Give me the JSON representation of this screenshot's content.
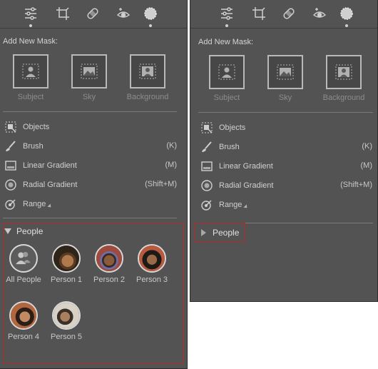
{
  "toolbar_icons": [
    "edit-sliders-icon",
    "crop-icon",
    "healing-icon",
    "red-eye-icon",
    "masking-icon"
  ],
  "add_new_mask": {
    "label": "Add New Mask:",
    "tiles": [
      {
        "name": "subject",
        "label": "Subject",
        "icon": "subject-icon"
      },
      {
        "name": "sky",
        "label": "Sky",
        "icon": "sky-icon"
      },
      {
        "name": "background",
        "label": "Background",
        "icon": "background-icon"
      }
    ]
  },
  "tools": [
    {
      "name": "objects",
      "label": "Objects",
      "shortcut": "",
      "icon": "objects-icon"
    },
    {
      "name": "brush",
      "label": "Brush",
      "shortcut": "(K)",
      "icon": "brush-icon"
    },
    {
      "name": "linear-gradient",
      "label": "Linear Gradient",
      "shortcut": "(M)",
      "icon": "linear-gradient-icon"
    },
    {
      "name": "radial-gradient",
      "label": "Radial Gradient",
      "shortcut": "(Shift+M)",
      "icon": "radial-gradient-icon"
    },
    {
      "name": "range",
      "label": "Range",
      "shortcut": "",
      "icon": "range-icon"
    }
  ],
  "people": {
    "label": "People",
    "items": [
      {
        "label": "All People"
      },
      {
        "label": "Person 1"
      },
      {
        "label": "Person 2"
      },
      {
        "label": "Person 3"
      },
      {
        "label": "Person 4"
      },
      {
        "label": "Person 5"
      }
    ]
  },
  "colors": {
    "panel_bg": "#535353",
    "highlight_border": "#b52a2a"
  }
}
